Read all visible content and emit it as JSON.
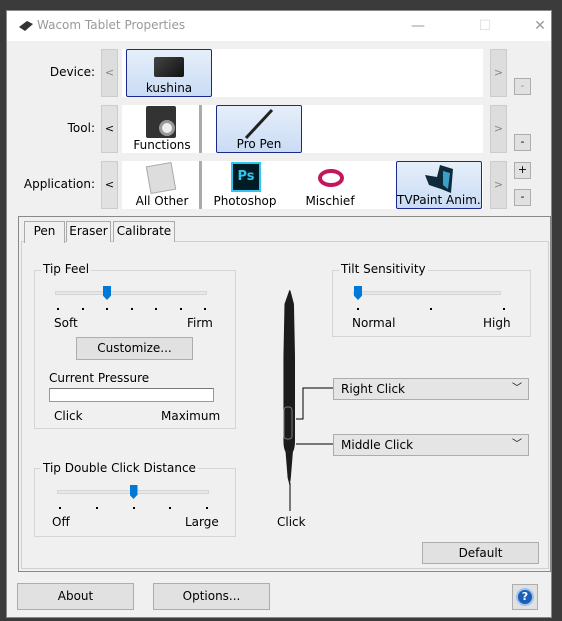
{
  "window": {
    "title": "Wacom Tablet Properties",
    "minimize": "—",
    "maximize": "☐",
    "close": "✕"
  },
  "device": {
    "label": "Device:",
    "items": [
      {
        "name": "kushina",
        "selected": true
      }
    ],
    "prev": "<",
    "next": ">",
    "remove": "-"
  },
  "tool": {
    "label": "Tool:",
    "items": [
      {
        "name": "Functions",
        "selected": false
      },
      {
        "name": "Pro Pen",
        "selected": true
      }
    ],
    "prev": "<",
    "next": ">",
    "remove": "-"
  },
  "application": {
    "label": "Application:",
    "items": [
      {
        "name": "All Other",
        "selected": false
      },
      {
        "name": "Photoshop",
        "selected": false
      },
      {
        "name": "Mischief",
        "selected": false
      },
      {
        "name": "TVPaint Anim...",
        "selected": true
      }
    ],
    "prev": "<",
    "next": ">",
    "add": "+",
    "remove": "-"
  },
  "tabs": [
    {
      "label": "Pen",
      "active": true
    },
    {
      "label": "Eraser",
      "active": false
    },
    {
      "label": "Calibrate",
      "active": false
    }
  ],
  "tip_feel": {
    "title": "Tip Feel",
    "min_label": "Soft",
    "max_label": "Firm",
    "ticks": 7,
    "value_index": 2,
    "customize": "Customize...",
    "pressure_label": "Current Pressure",
    "pressure_value": 0,
    "pressure_min": "Click",
    "pressure_max": "Maximum"
  },
  "double_click": {
    "title": "Tip Double Click Distance",
    "min_label": "Off",
    "max_label": "Large",
    "ticks": 5,
    "value_index": 2
  },
  "tilt": {
    "title": "Tilt Sensitivity",
    "min_label": "Normal",
    "max_label": "High",
    "ticks": 3,
    "value_index": 0
  },
  "pen": {
    "upper_button": "Right Click",
    "lower_button": "Middle Click",
    "tip": "Click"
  },
  "buttons": {
    "default": "Default",
    "about": "About",
    "options": "Options...",
    "help": "?"
  },
  "colors": {
    "accent": "#0078d7",
    "selection": "#c9dcf5"
  }
}
